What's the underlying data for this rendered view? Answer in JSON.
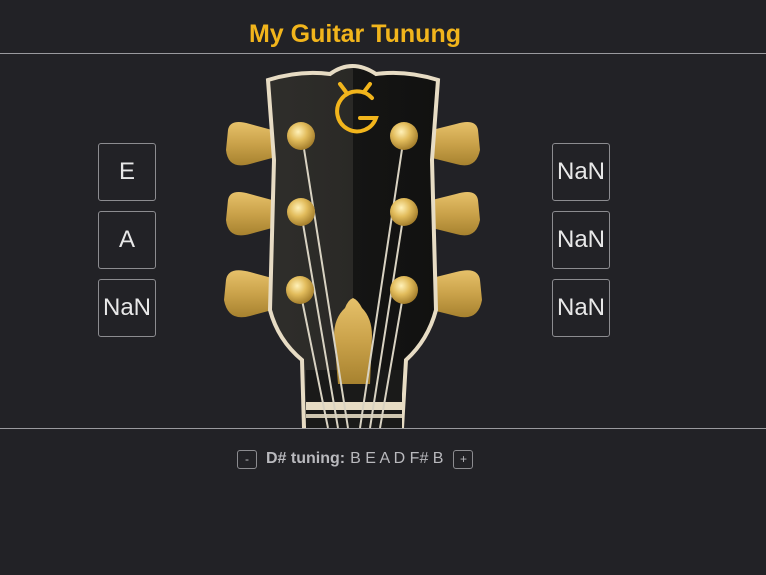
{
  "app": {
    "title": "My Guitar Tunung"
  },
  "strings_left": [
    "E",
    "A",
    "NaN"
  ],
  "strings_right": [
    "NaN",
    "NaN",
    "NaN"
  ],
  "tuning": {
    "name": "D# tuning:",
    "notes": "B E A D F# B",
    "decrement_label": "-",
    "increment_label": "+"
  },
  "logo": {
    "icon": "gibson-g-logo-icon"
  },
  "colors": {
    "accent": "#f2b51c",
    "background": "#222226",
    "headstock_left": "#2b2a27",
    "headstock_right": "#141413",
    "binding": "#e7dcc4",
    "gold": "#caa24a"
  }
}
